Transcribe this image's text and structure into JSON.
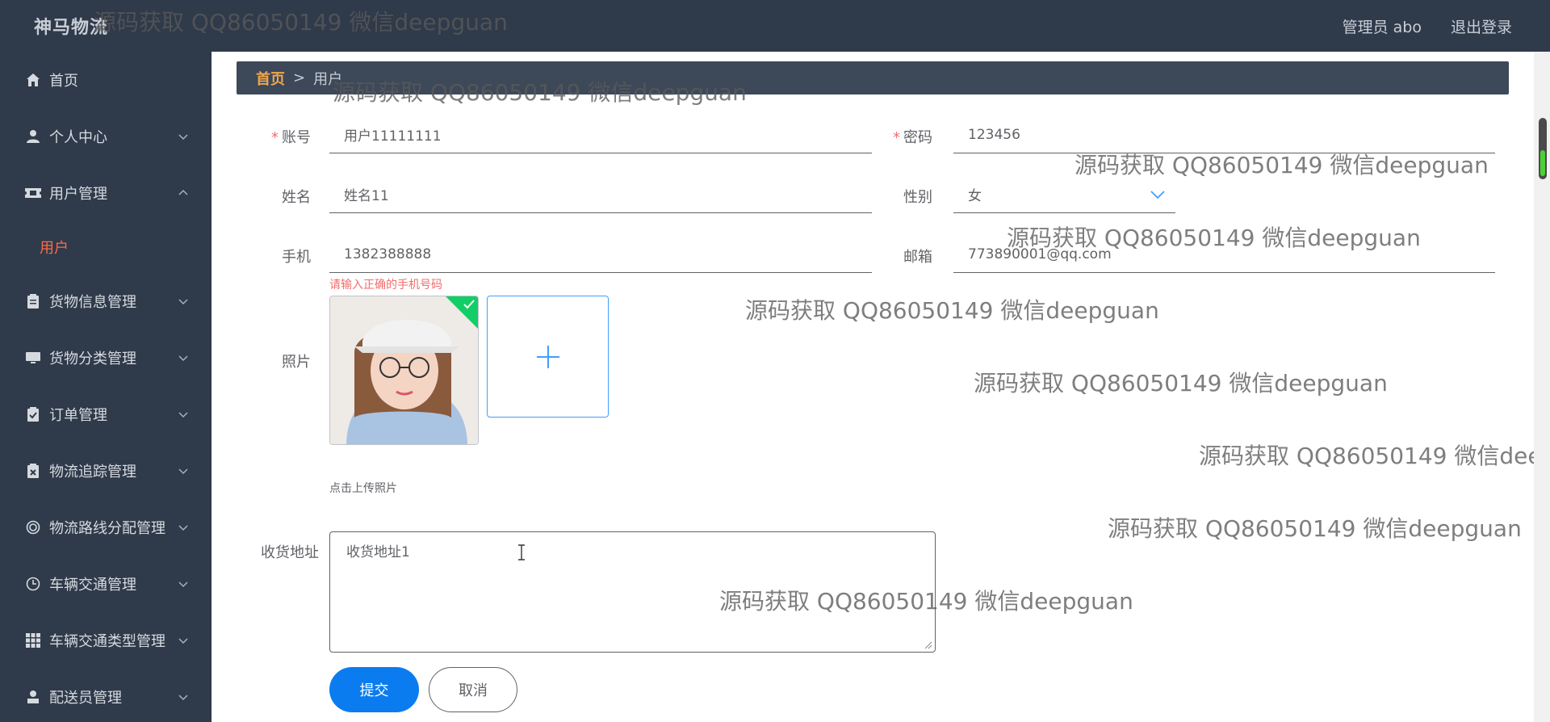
{
  "app": {
    "brand": "神马物流",
    "user_label": "管理员 abo",
    "logout_label": "退出登录"
  },
  "sidebar": {
    "items": [
      {
        "label": "首页",
        "icon": "home-icon"
      },
      {
        "label": "个人中心",
        "icon": "user-icon"
      },
      {
        "label": "用户管理",
        "icon": "ticket-icon",
        "expanded": true
      },
      {
        "label": "货物信息管理",
        "icon": "clipboard-icon"
      },
      {
        "label": "货物分类管理",
        "icon": "monitor-icon"
      },
      {
        "label": "订单管理",
        "icon": "checklist-icon"
      },
      {
        "label": "物流追踪管理",
        "icon": "delete-clipboard-icon"
      },
      {
        "label": "物流路线分配管理",
        "icon": "circle-icon"
      },
      {
        "label": "车辆交通管理",
        "icon": "clock-icon"
      },
      {
        "label": "车辆交通类型管理",
        "icon": "grid-icon"
      },
      {
        "label": "配送员管理",
        "icon": "person-icon"
      }
    ],
    "sub_item": "用户"
  },
  "breadcrumb": {
    "home": "首页",
    "separator": ">",
    "current": "用户"
  },
  "form": {
    "account_label": "账号",
    "account_value": "用户11111111",
    "password_label": "密码",
    "password_value": "123456",
    "name_label": "姓名",
    "name_value": "姓名11",
    "gender_label": "性别",
    "gender_value": "女",
    "phone_label": "手机",
    "phone_value": "1382388888",
    "phone_error": "请输入正确的手机号码",
    "email_label": "邮箱",
    "email_value": "773890001@qq.com",
    "photo_label": "照片",
    "upload_tip": "点击上传照片",
    "address_label": "收货地址",
    "address_value": "收货地址1",
    "submit_label": "提交",
    "cancel_label": "取消"
  },
  "watermark_text": "源码获取 QQ86050149 微信deepguan",
  "colors": {
    "header_bg": "#2f3a4a",
    "sidebar_bg": "#2f3a4a",
    "active_sub": "#ff6b4a",
    "crumb_home": "#f0a64a",
    "primary": "#0a7cf0",
    "error": "#f56c6c"
  }
}
